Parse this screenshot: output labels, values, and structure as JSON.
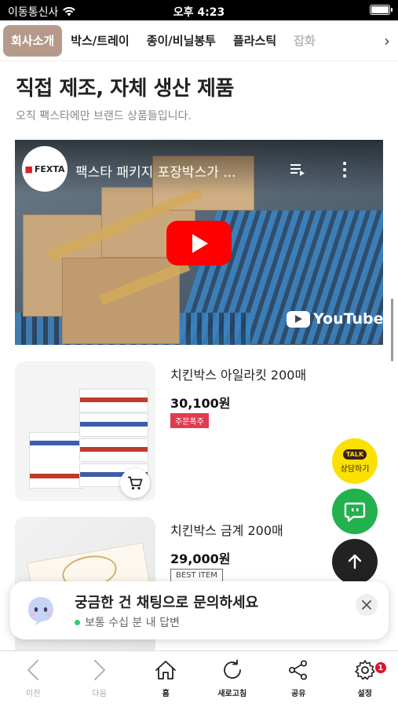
{
  "status_bar": {
    "carrier": "이동통신사",
    "time": "오후 4:23"
  },
  "category_nav": {
    "items": [
      {
        "label": "회사소개",
        "active": true
      },
      {
        "label": "박스/트레이"
      },
      {
        "label": "종이/비닐봉투"
      },
      {
        "label": "플라스틱"
      },
      {
        "label": "잡화"
      }
    ],
    "more_icon": "chevron-right-icon"
  },
  "section": {
    "title": "직접 제조, 자체 생산 제품",
    "subtitle": "오직 팩스타에만 브랜드 상품들입니다."
  },
  "video": {
    "channel_logo_text": "FEXTA",
    "title": "팩스타 패키지 포장박스가 ...",
    "brand": "YouTube"
  },
  "products": [
    {
      "name": "치킨박스 아일라킷 200매",
      "price": "30,100원",
      "badge": "주문폭주",
      "badge_style": "red"
    },
    {
      "name": "치킨박스 금계 200매",
      "price": "29,000원",
      "badge": "BEST ITEM",
      "badge_style": "outline"
    }
  ],
  "floating": {
    "talk_bubble": "TALK",
    "talk_label": "상담하기"
  },
  "chat_banner": {
    "title": "궁금한 건 채팅으로 문의하세요",
    "subtitle": "보통 수십 분 내 답변"
  },
  "toolbar": {
    "items": [
      {
        "label": "이전",
        "icon": "back-arrow-icon",
        "disabled": true
      },
      {
        "label": "다음",
        "icon": "forward-arrow-icon",
        "disabled": true
      },
      {
        "label": "홈",
        "icon": "home-icon"
      },
      {
        "label": "새로고침",
        "icon": "refresh-icon"
      },
      {
        "label": "공유",
        "icon": "share-icon"
      },
      {
        "label": "설정",
        "icon": "gear-icon",
        "badge": "1"
      }
    ]
  },
  "colors": {
    "active_tab": "#b59a8b",
    "badge_red": "#e33a50",
    "kakao_yellow": "#fae100",
    "chat_green": "#22b14c",
    "youtube_red": "#ff0000"
  }
}
